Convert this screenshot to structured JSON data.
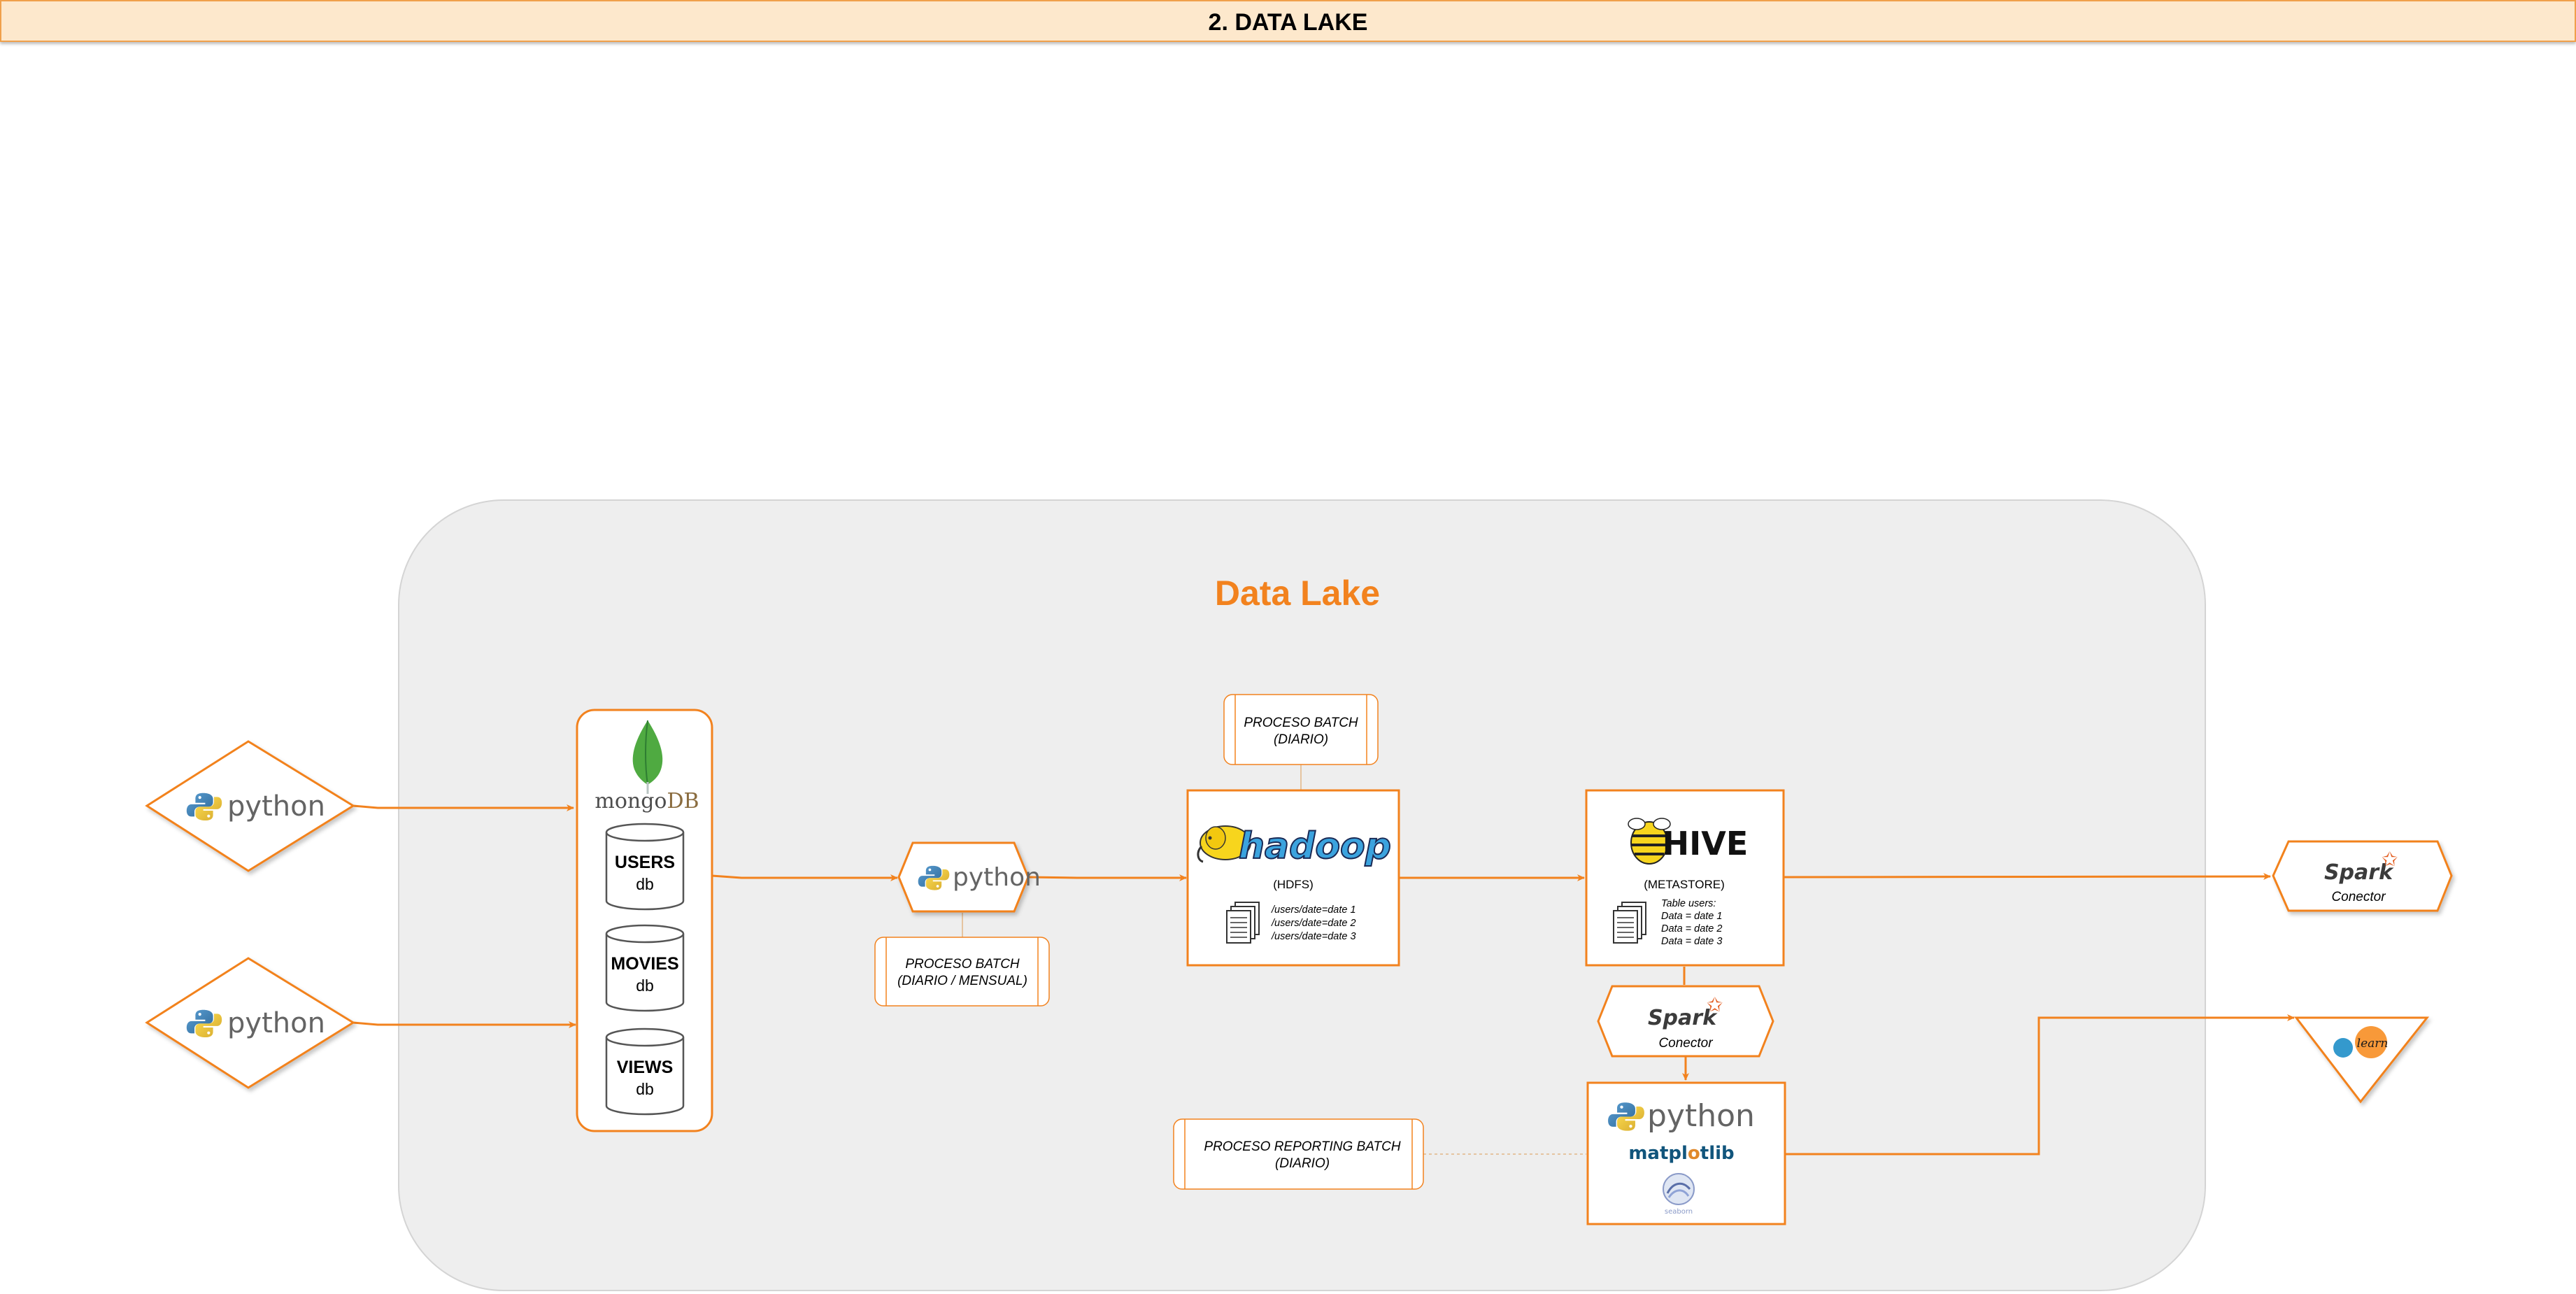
{
  "header": {
    "title": "2. DATA LAKE"
  },
  "lake": {
    "title": "Data Lake"
  },
  "colors": {
    "accent": "#f2821e",
    "lake_bg": "#eeeeee",
    "header_bg": "#fde8cc"
  },
  "sources": [
    {
      "logo": "python"
    },
    {
      "logo": "python"
    }
  ],
  "mongo": {
    "logo": "mongoDB",
    "logo_parts": [
      "mongo",
      "DB"
    ],
    "dbs": [
      {
        "name": "USERS",
        "sub": "db"
      },
      {
        "name": "MOVIES",
        "sub": "db"
      },
      {
        "name": "VIEWS",
        "sub": "db"
      }
    ]
  },
  "etl": {
    "logo": "python",
    "note_line1": "PROCESO BATCH",
    "note_line2": "(DIARIO / MENSUAL)"
  },
  "hadoop": {
    "logo": "hadoop",
    "label": "(HDFS)",
    "files": [
      "/users/date=date 1",
      "/users/date=date 2",
      "/users/date=date 3"
    ],
    "note_line1": "PROCESO BATCH",
    "note_line2": "(DIARIO)"
  },
  "hive": {
    "logo": "HIVE",
    "label": "(METASTORE)",
    "lines": [
      "Table users:",
      "Data = date 1",
      "Data = date 2",
      "Data = date 3"
    ]
  },
  "spark_mid": {
    "logo": "Spark",
    "label": "Conector"
  },
  "spark_out": {
    "logo": "Spark",
    "label": "Conector"
  },
  "reporting": {
    "logo": "python",
    "lib1": "matplotlib",
    "lib1_parts": [
      "matpl",
      "tlib"
    ],
    "lib2": "seaborn",
    "note_line1": "PROCESO REPORTING BATCH",
    "note_line2": "(DIARIO)"
  },
  "sklearn": {
    "logo": "learn"
  }
}
